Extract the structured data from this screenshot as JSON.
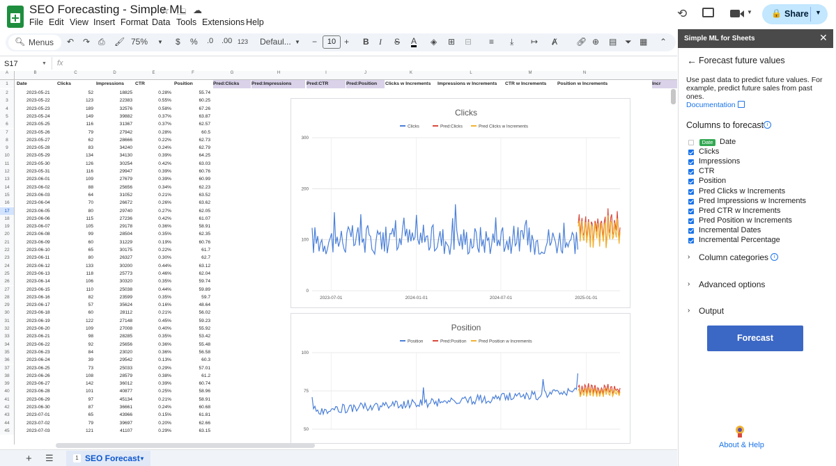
{
  "title_bar": {
    "doc_title": "SEO Forecasting - Simple ML",
    "share_label": "Share"
  },
  "menu": [
    "File",
    "Edit",
    "View",
    "Insert",
    "Format",
    "Data",
    "Tools",
    "Extensions",
    "Help"
  ],
  "toolbar": {
    "menus_label": "Menus",
    "zoom": "75%",
    "currency": "$",
    "percent": "%",
    "decrease_decimal": ".0",
    "increase_decimal": ".00",
    "number_format": "123",
    "font": "Defaul...",
    "font_size": "10"
  },
  "formula_bar": {
    "cell_ref": "S17",
    "fx": "fx"
  },
  "columns": [
    "A",
    "B",
    "C",
    "D",
    "E",
    "F",
    "G",
    "H",
    "I",
    "J",
    "K",
    "L",
    "M",
    "N"
  ],
  "header_row": [
    "Date",
    "Clicks",
    "Impressions",
    "CTR",
    "Position",
    "Pred:Clicks",
    "Pred:Impressions",
    "Pred:CTR",
    "Pred:Position",
    "Clicks w Increments",
    "Impressions w Increments",
    "CTR w Increments",
    "Position w Increments",
    "",
    "Incr"
  ],
  "rows": [
    [
      "2",
      "2023-05-21",
      "52",
      "18825",
      "0.28%",
      "55.74"
    ],
    [
      "3",
      "2023-05-22",
      "123",
      "22383",
      "0.55%",
      "60.25"
    ],
    [
      "4",
      "2023-05-23",
      "189",
      "32576",
      "0.58%",
      "67.26"
    ],
    [
      "5",
      "2023-05-24",
      "149",
      "39882",
      "0.37%",
      "63.87"
    ],
    [
      "6",
      "2023-05-25",
      "116",
      "31367",
      "0.37%",
      "62.57"
    ],
    [
      "7",
      "2023-05-26",
      "79",
      "27942",
      "0.28%",
      "60.5"
    ],
    [
      "8",
      "2023-05-27",
      "62",
      "28666",
      "0.22%",
      "62.73"
    ],
    [
      "9",
      "2023-05-28",
      "83",
      "34240",
      "0.24%",
      "62.79"
    ],
    [
      "10",
      "2023-05-29",
      "134",
      "34130",
      "0.39%",
      "64.25"
    ],
    [
      "11",
      "2023-05-30",
      "126",
      "30254",
      "0.42%",
      "63.03"
    ],
    [
      "12",
      "2023-05-31",
      "116",
      "29947",
      "0.39%",
      "60.76"
    ],
    [
      "13",
      "2023-06-01",
      "109",
      "27679",
      "0.39%",
      "60.99"
    ],
    [
      "14",
      "2023-06-02",
      "88",
      "25656",
      "0.34%",
      "62.23"
    ],
    [
      "15",
      "2023-06-03",
      "64",
      "31052",
      "0.21%",
      "63.52"
    ],
    [
      "16",
      "2023-06-04",
      "70",
      "26672",
      "0.26%",
      "63.62"
    ],
    [
      "17",
      "2023-06-05",
      "80",
      "29740",
      "0.27%",
      "62.05"
    ],
    [
      "18",
      "2023-06-06",
      "115",
      "27236",
      "0.42%",
      "61.07"
    ],
    [
      "19",
      "2023-06-07",
      "105",
      "29178",
      "0.36%",
      "58.91"
    ],
    [
      "20",
      "2023-06-08",
      "99",
      "28504",
      "0.35%",
      "62.35"
    ],
    [
      "21",
      "2023-06-09",
      "60",
      "31229",
      "0.19%",
      "60.76"
    ],
    [
      "22",
      "2023-06-10",
      "65",
      "30175",
      "0.22%",
      "61.7"
    ],
    [
      "23",
      "2023-06-11",
      "80",
      "26327",
      "0.30%",
      "62.7"
    ],
    [
      "24",
      "2023-06-12",
      "133",
      "30200",
      "0.44%",
      "63.12"
    ],
    [
      "25",
      "2023-06-13",
      "118",
      "25773",
      "0.46%",
      "62.04"
    ],
    [
      "26",
      "2023-06-14",
      "106",
      "30320",
      "0.35%",
      "59.74"
    ],
    [
      "27",
      "2023-06-15",
      "110",
      "25038",
      "0.44%",
      "59.89"
    ],
    [
      "28",
      "2023-06-16",
      "82",
      "23599",
      "0.35%",
      "59.7"
    ],
    [
      "29",
      "2023-06-17",
      "57",
      "35624",
      "0.16%",
      "48.64"
    ],
    [
      "30",
      "2023-06-18",
      "60",
      "28112",
      "0.21%",
      "56.02"
    ],
    [
      "31",
      "2023-06-19",
      "122",
      "27148",
      "0.45%",
      "59.23"
    ],
    [
      "32",
      "2023-06-20",
      "109",
      "27008",
      "0.40%",
      "55.92"
    ],
    [
      "33",
      "2023-06-21",
      "98",
      "28285",
      "0.35%",
      "53.42"
    ],
    [
      "34",
      "2023-06-22",
      "92",
      "25656",
      "0.36%",
      "55.48"
    ],
    [
      "35",
      "2023-06-23",
      "84",
      "23020",
      "0.36%",
      "56.58"
    ],
    [
      "36",
      "2023-06-24",
      "39",
      "29542",
      "0.13%",
      "60.3"
    ],
    [
      "37",
      "2023-06-25",
      "73",
      "25033",
      "0.29%",
      "57.01"
    ],
    [
      "38",
      "2023-06-26",
      "108",
      "28579",
      "0.38%",
      "61.2"
    ],
    [
      "39",
      "2023-06-27",
      "142",
      "36012",
      "0.39%",
      "60.74"
    ],
    [
      "40",
      "2023-06-28",
      "101",
      "40877",
      "0.25%",
      "58.96"
    ],
    [
      "41",
      "2023-06-29",
      "97",
      "45134",
      "0.21%",
      "58.91"
    ],
    [
      "42",
      "2023-06-30",
      "87",
      "36661",
      "0.24%",
      "60.68"
    ],
    [
      "43",
      "2023-07-01",
      "65",
      "43966",
      "0.15%",
      "61.81"
    ],
    [
      "44",
      "2023-07-02",
      "79",
      "39697",
      "0.20%",
      "62.66"
    ],
    [
      "45",
      "2023-07-03",
      "121",
      "41107",
      "0.29%",
      "63.15"
    ]
  ],
  "sheet_tab": {
    "number": "1",
    "name": "SEO Forecast"
  },
  "chart_data": [
    {
      "type": "line",
      "title": "Clicks",
      "legend": [
        "Clicks",
        "Pred:Clicks",
        "Pred Clicks w Increments"
      ],
      "legend_position": "top",
      "colors": [
        "#4a7fd8",
        "#d9483b",
        "#f2b233"
      ],
      "ylim": [
        0,
        300
      ],
      "yticks": [
        "0",
        "100",
        "200",
        "300"
      ],
      "xticks": [
        "2023-07-01",
        "2024-01-01",
        "2024-07-01",
        "2025-01-01"
      ],
      "actual_range": [
        "2023-05-21",
        "2024-12-15"
      ],
      "forecast_range": [
        "2024-12-15",
        "2025-03-15"
      ],
      "actual_mean": 100,
      "actual_swing": 30,
      "forecast_mean": 115,
      "forecast_swing": 40
    },
    {
      "type": "line",
      "title": "Position",
      "legend": [
        "Position",
        "Pred:Position",
        "Pred Position w Increments"
      ],
      "legend_position": "top",
      "colors": [
        "#4a7fd8",
        "#d9483b",
        "#f2b233"
      ],
      "ylim": [
        50,
        100
      ],
      "yticks": [
        "50",
        "75",
        "100"
      ],
      "actual_range": [
        "2023-05-21",
        "2024-12-15"
      ],
      "forecast_range": [
        "2024-12-15",
        "2025-03-15"
      ],
      "actual_start": 62,
      "actual_end": 74,
      "actual_swing": 3,
      "forecast_mean": 74,
      "forecast_swing": 4
    }
  ],
  "sidebar": {
    "header": "Simple ML for Sheets",
    "title": "Forecast future values",
    "description": "Use past data to predict future values. For example, predict future sales from past ones.",
    "doc_link": "Documentation",
    "columns_heading": "Columns to forecast",
    "date_badge": "Date",
    "columns": [
      {
        "label": "Date",
        "checked": false
      },
      {
        "label": "Clicks",
        "checked": true
      },
      {
        "label": "Impressions",
        "checked": true
      },
      {
        "label": "CTR",
        "checked": true
      },
      {
        "label": "Position",
        "checked": true
      },
      {
        "label": "Pred Clicks w Increments",
        "checked": true
      },
      {
        "label": "Pred Impressions w Increments",
        "checked": true
      },
      {
        "label": "Pred CTR w Increments",
        "checked": true
      },
      {
        "label": "Pred Position w Increments",
        "checked": true
      },
      {
        "label": "Incremental Dates",
        "checked": true
      },
      {
        "label": "Incremental Percentage",
        "checked": true
      }
    ],
    "column_categories": "Column categories",
    "advanced_options": "Advanced options",
    "output": "Output",
    "forecast_button": "Forecast",
    "about": "About & Help"
  }
}
